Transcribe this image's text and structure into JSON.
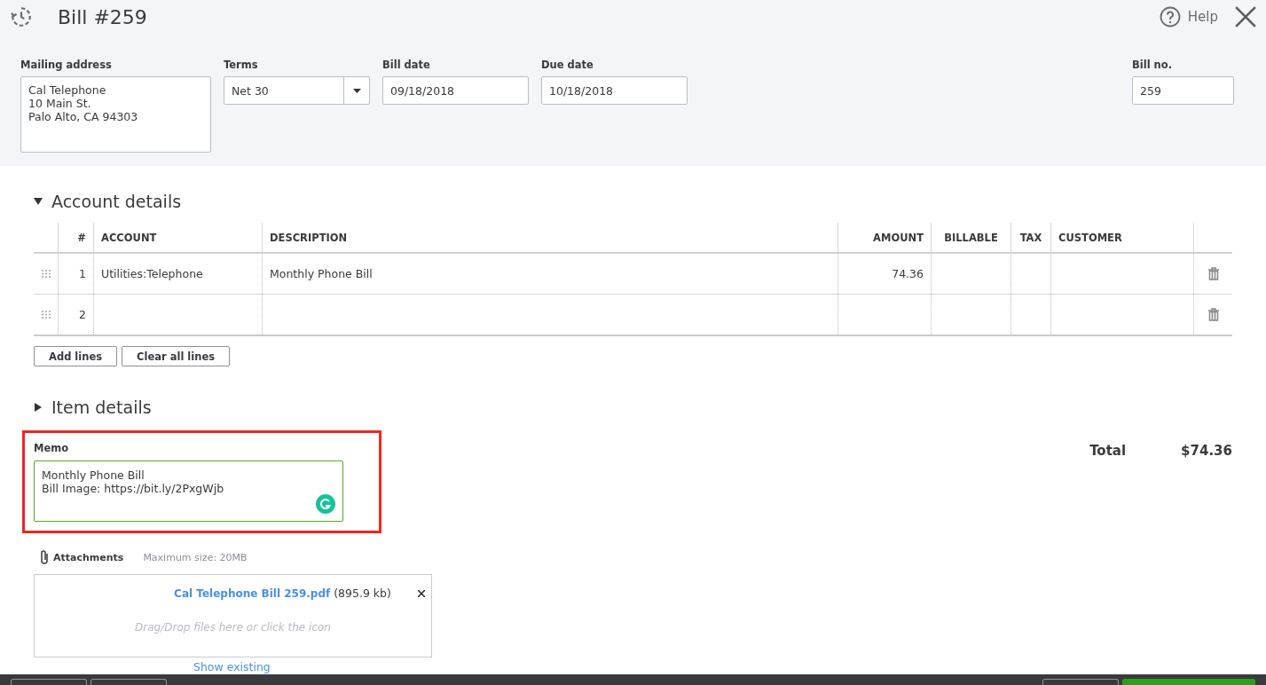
{
  "header": {
    "title": "Bill #259",
    "help": "Help"
  },
  "fields": {
    "mailing_address": {
      "label": "Mailing address",
      "lines": [
        "Cal Telephone",
        "10 Main St.",
        "Palo Alto, CA  94303"
      ]
    },
    "terms": {
      "label": "Terms",
      "value": "Net 30"
    },
    "bill_date": {
      "label": "Bill date",
      "value": "09/18/2018"
    },
    "due_date": {
      "label": "Due date",
      "value": "10/18/2018"
    },
    "bill_no": {
      "label": "Bill no.",
      "value": "259"
    }
  },
  "account_details": {
    "heading": "Account details",
    "expanded": true,
    "columns": [
      "#",
      "ACCOUNT",
      "DESCRIPTION",
      "AMOUNT",
      "BILLABLE",
      "TAX",
      "CUSTOMER"
    ],
    "rows": [
      {
        "num": "1",
        "account": "Utilities:Telephone",
        "description": "Monthly Phone Bill",
        "amount": "74.36"
      },
      {
        "num": "2"
      }
    ],
    "buttons": [
      "Add lines",
      "Clear all lines"
    ]
  },
  "item_details": {
    "heading": "Item details",
    "expanded": false
  },
  "memo": {
    "label": "Memo",
    "lines": [
      "Monthly Phone Bill",
      "Bill Image: https://bit.ly/2PxgWjb"
    ],
    "highlighted": true
  },
  "total": {
    "label": "Total",
    "value": "$74.36"
  },
  "attachments": {
    "label": "Attachments",
    "max_size": "Maximum size: 20MB",
    "file": {
      "name": "Cal Telephone Bill 259.pdf",
      "size": "(895.9 kb)"
    },
    "drop_hint": "Drag/Drop files here or click the icon",
    "show_existing": "Show existing"
  }
}
